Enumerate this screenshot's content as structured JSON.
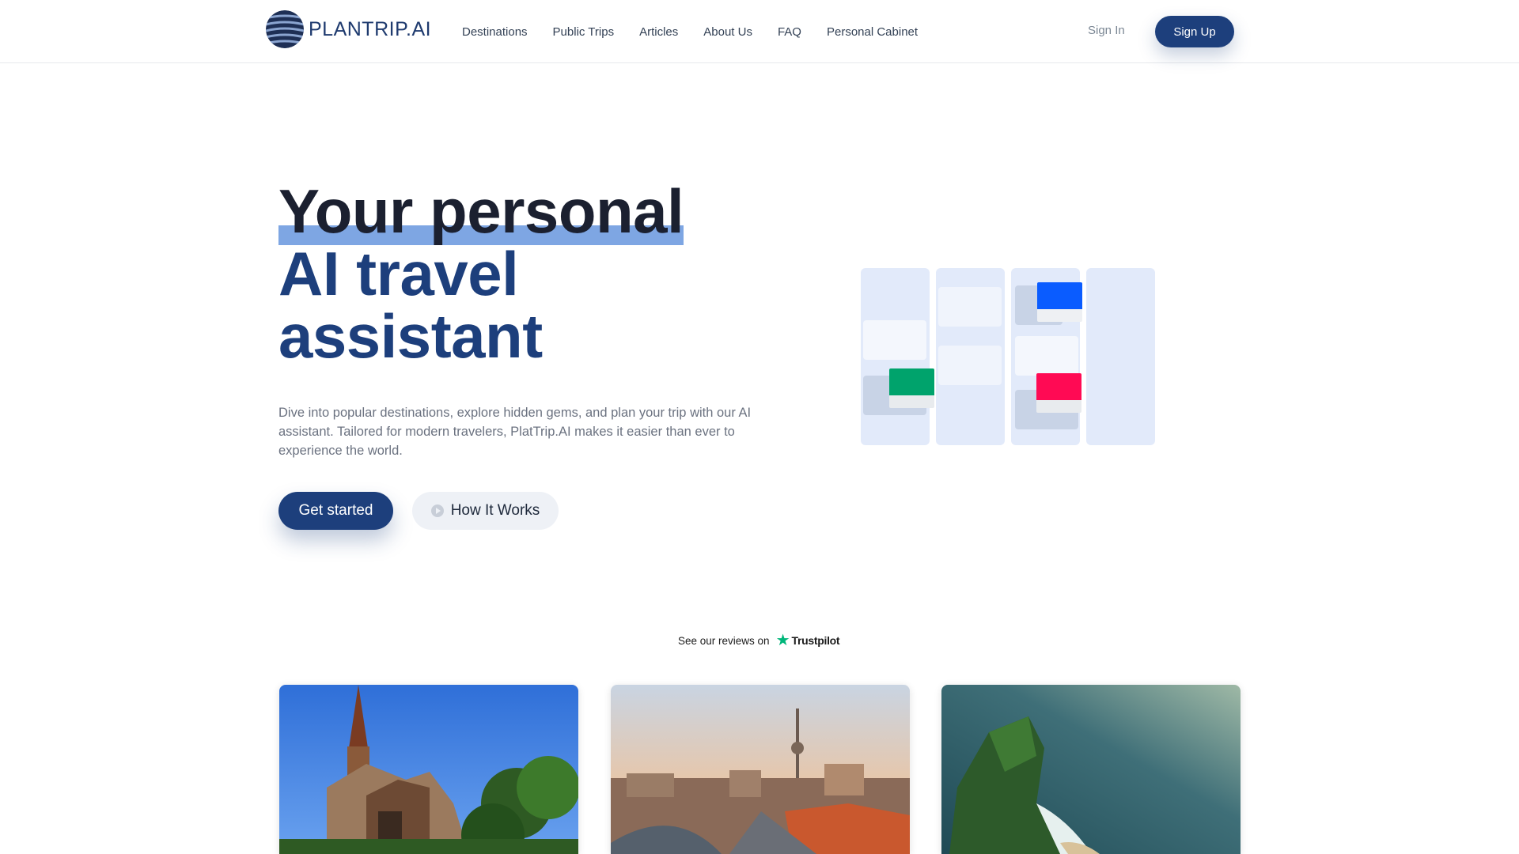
{
  "header": {
    "logo_text": "PLANTRIP.AI",
    "nav": [
      "Destinations",
      "Public Trips",
      "Articles",
      "About Us",
      "FAQ",
      "Personal Cabinet"
    ],
    "sign_in": "Sign In",
    "sign_up": "Sign Up"
  },
  "hero": {
    "title_line1": "Your personal",
    "title_line2": "AI travel",
    "title_line3": "assistant",
    "description": "Dive into popular destinations, explore hidden gems, and plan your trip with our AI assistant. Tailored for modern travelers, PlatTrip.AI makes it easier than ever to experience the world.",
    "cta_primary": "Get started",
    "cta_secondary": "How It Works"
  },
  "trustpilot": {
    "prefix": "See our reviews on",
    "brand": "Trustpilot"
  },
  "illustration": {
    "accent_colors": [
      "#0a5cff",
      "#00a36c",
      "#ff0a54"
    ]
  },
  "destination_cards": [
    {
      "image": "church-photo"
    },
    {
      "image": "city-skyline-photo"
    },
    {
      "image": "coastal-cliff-photo"
    }
  ],
  "colors": {
    "brand": "#1d3f7c",
    "highlight": "#7ea6e3"
  }
}
